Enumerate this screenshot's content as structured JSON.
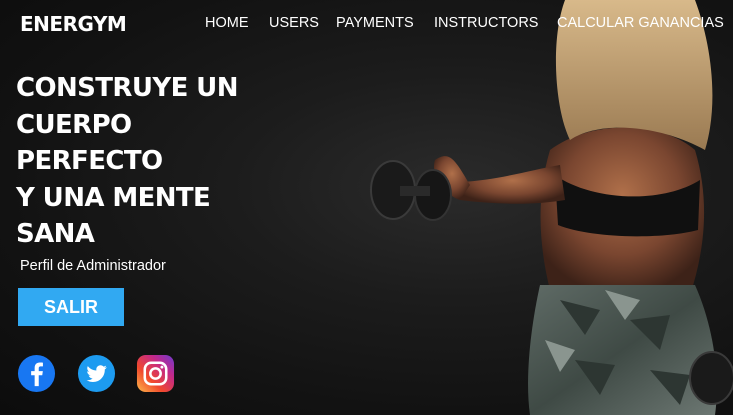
{
  "brand": "ENERGYM",
  "nav": {
    "home": "HOME",
    "users": "USERS",
    "payments": "PAYMENTS",
    "instructors": "INSTRUCTORS",
    "calc": "CALCULAR GANANCIAS"
  },
  "hero": {
    "lines": [
      "CONSTRUYE UN",
      "CUERPO",
      "PERFECTO",
      "Y UNA MENTE",
      "SANA"
    ],
    "subtitle": "Perfil de Administrador",
    "button_label": "SALIR"
  },
  "social": {
    "facebook_icon": "facebook-icon",
    "twitter_icon": "twitter-icon",
    "instagram_icon": "instagram-icon"
  },
  "colors": {
    "accent": "#31a9f2",
    "background": "#141414",
    "text": "#ffffff"
  }
}
